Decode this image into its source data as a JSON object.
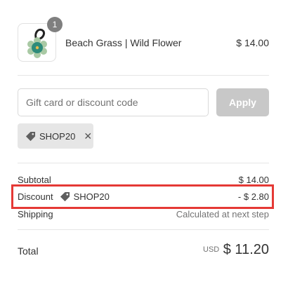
{
  "order": {
    "item": {
      "quantity": "1",
      "name": "Beach Grass | Wild Flower",
      "price": "$ 14.00",
      "thumbnail_icon": "green-flower-ornament-image"
    }
  },
  "discount_form": {
    "placeholder": "Gift card or discount code",
    "apply_label": "Apply",
    "applied_tag": {
      "code": "SHOP20",
      "icon": "tag-icon",
      "remove_icon": "close-icon",
      "remove_glyph": "✕"
    }
  },
  "summary": {
    "subtotal_label": "Subtotal",
    "subtotal_value": "$ 14.00",
    "discount_label": "Discount",
    "discount_code": "SHOP20",
    "discount_value": "- $ 2.80",
    "shipping_label": "Shipping",
    "shipping_value": "Calculated at next step"
  },
  "total": {
    "label": "Total",
    "currency": "USD",
    "amount": "$ 11.20"
  },
  "colors": {
    "highlight": "#e53935",
    "apply_button": "#c8c8c8",
    "tag_background": "#e6e6e6",
    "badge": "#7f7f7f"
  }
}
